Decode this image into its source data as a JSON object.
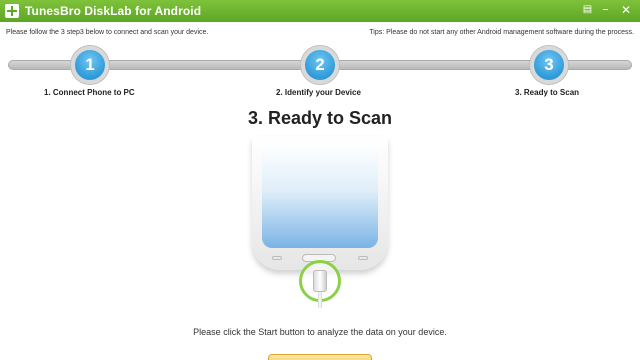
{
  "window": {
    "title": "TunesBro DiskLab for Android",
    "controls": [
      "▤",
      "–",
      "✕"
    ]
  },
  "info": {
    "left": "Please follow the 3 step3 below to connect and scan your device.",
    "right": "Tips: Please do not start any other Android management software during the process."
  },
  "steps": [
    {
      "number": "1",
      "label": "1. Connect Phone to PC"
    },
    {
      "number": "2",
      "label": "2. Identify your Device"
    },
    {
      "number": "3",
      "label": "3. Ready to Scan"
    }
  ],
  "main": {
    "heading": "3. Ready to Scan",
    "instruction": "Please click the Start button to analyze the data on your device."
  },
  "colors": {
    "titlebar": "#6bb42e",
    "step_circle": "#3aa3de",
    "usb_ring": "#8cd04a"
  }
}
